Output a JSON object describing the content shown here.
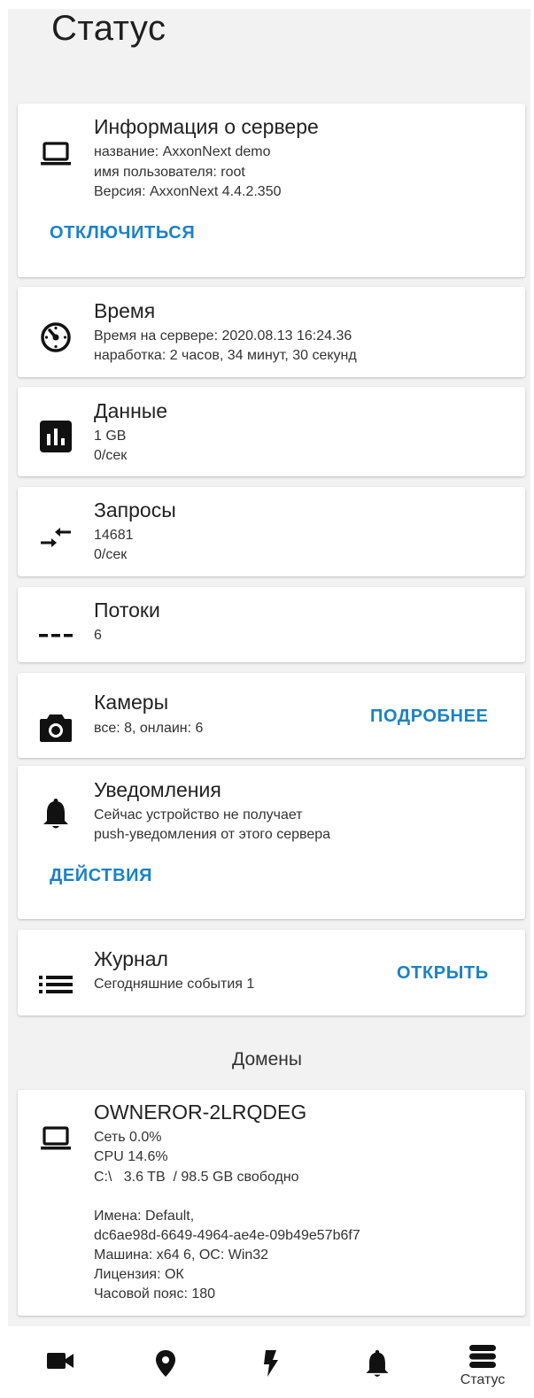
{
  "page": {
    "title": "Статус"
  },
  "server_info": {
    "title": "Информация о сервере",
    "name": "название: AxxonNext demo",
    "user": "имя пользователя: root",
    "version": "Версия: AxxonNext 4.4.2.350",
    "action": "ОТКЛЮЧИТЬСЯ",
    "icon": "laptop-icon"
  },
  "time": {
    "title": "Время",
    "server_time": "Время на сервере: 2020.08.13 16:24.36",
    "uptime": "наработка: 2 часов, 34 минут, 30 секунд",
    "icon": "timer-icon"
  },
  "data": {
    "title": "Данные",
    "size": "1 GB",
    "rate": "0/сек",
    "icon": "bar-chart-icon"
  },
  "requests": {
    "title": "Запросы",
    "count": "14681",
    "rate": "0/сек",
    "icon": "compare-arrows-icon"
  },
  "streams": {
    "title": "Потоки",
    "count": "6",
    "icon": "dashes-icon"
  },
  "cameras": {
    "title": "Камеры",
    "summary": "все: 8, онлаин: 6",
    "action": "ПОДРОБНЕЕ",
    "icon": "camera-icon"
  },
  "notifications": {
    "title": "Уведомления",
    "line1": "Сейчас устройство не получает",
    "line2": "push-уведомления от этого сервера",
    "action": "ДЕЙСТВИЯ",
    "icon": "bell-icon"
  },
  "journal": {
    "title": "Журнал",
    "events": "Сегодняшние события 1",
    "action": "ОТКРЫТЬ",
    "icon": "list-icon"
  },
  "domains": {
    "header": "Домены",
    "host": {
      "name": "OWNEROR-2LRQDEG",
      "network": "Сеть 0.0%",
      "cpu": "CPU 14.6%",
      "disk": "C:\\   3.6 TB  / 98.5 GB свободно",
      "names": "Имена: Default,",
      "guid": "dc6ae98d-6649-4964-ae4e-09b49e57b6f7",
      "machine": "Машина: x64 6, ОС: Win32",
      "license": "Лицензия: ОК",
      "timezone": "Часовой пояс: 180",
      "icon": "laptop-icon"
    }
  },
  "bottom_nav": {
    "items": [
      {
        "icon": "video-camera-icon",
        "label": ""
      },
      {
        "icon": "map-pin-icon",
        "label": ""
      },
      {
        "icon": "lightning-icon",
        "label": ""
      },
      {
        "icon": "bell-icon",
        "label": ""
      },
      {
        "icon": "server-stack-icon",
        "label": "Статус"
      }
    ],
    "active_index": 4
  },
  "colors": {
    "accent": "#1a82c8",
    "background": "#f2f2f2",
    "card": "#ffffff",
    "text": "#1a1a1a"
  }
}
